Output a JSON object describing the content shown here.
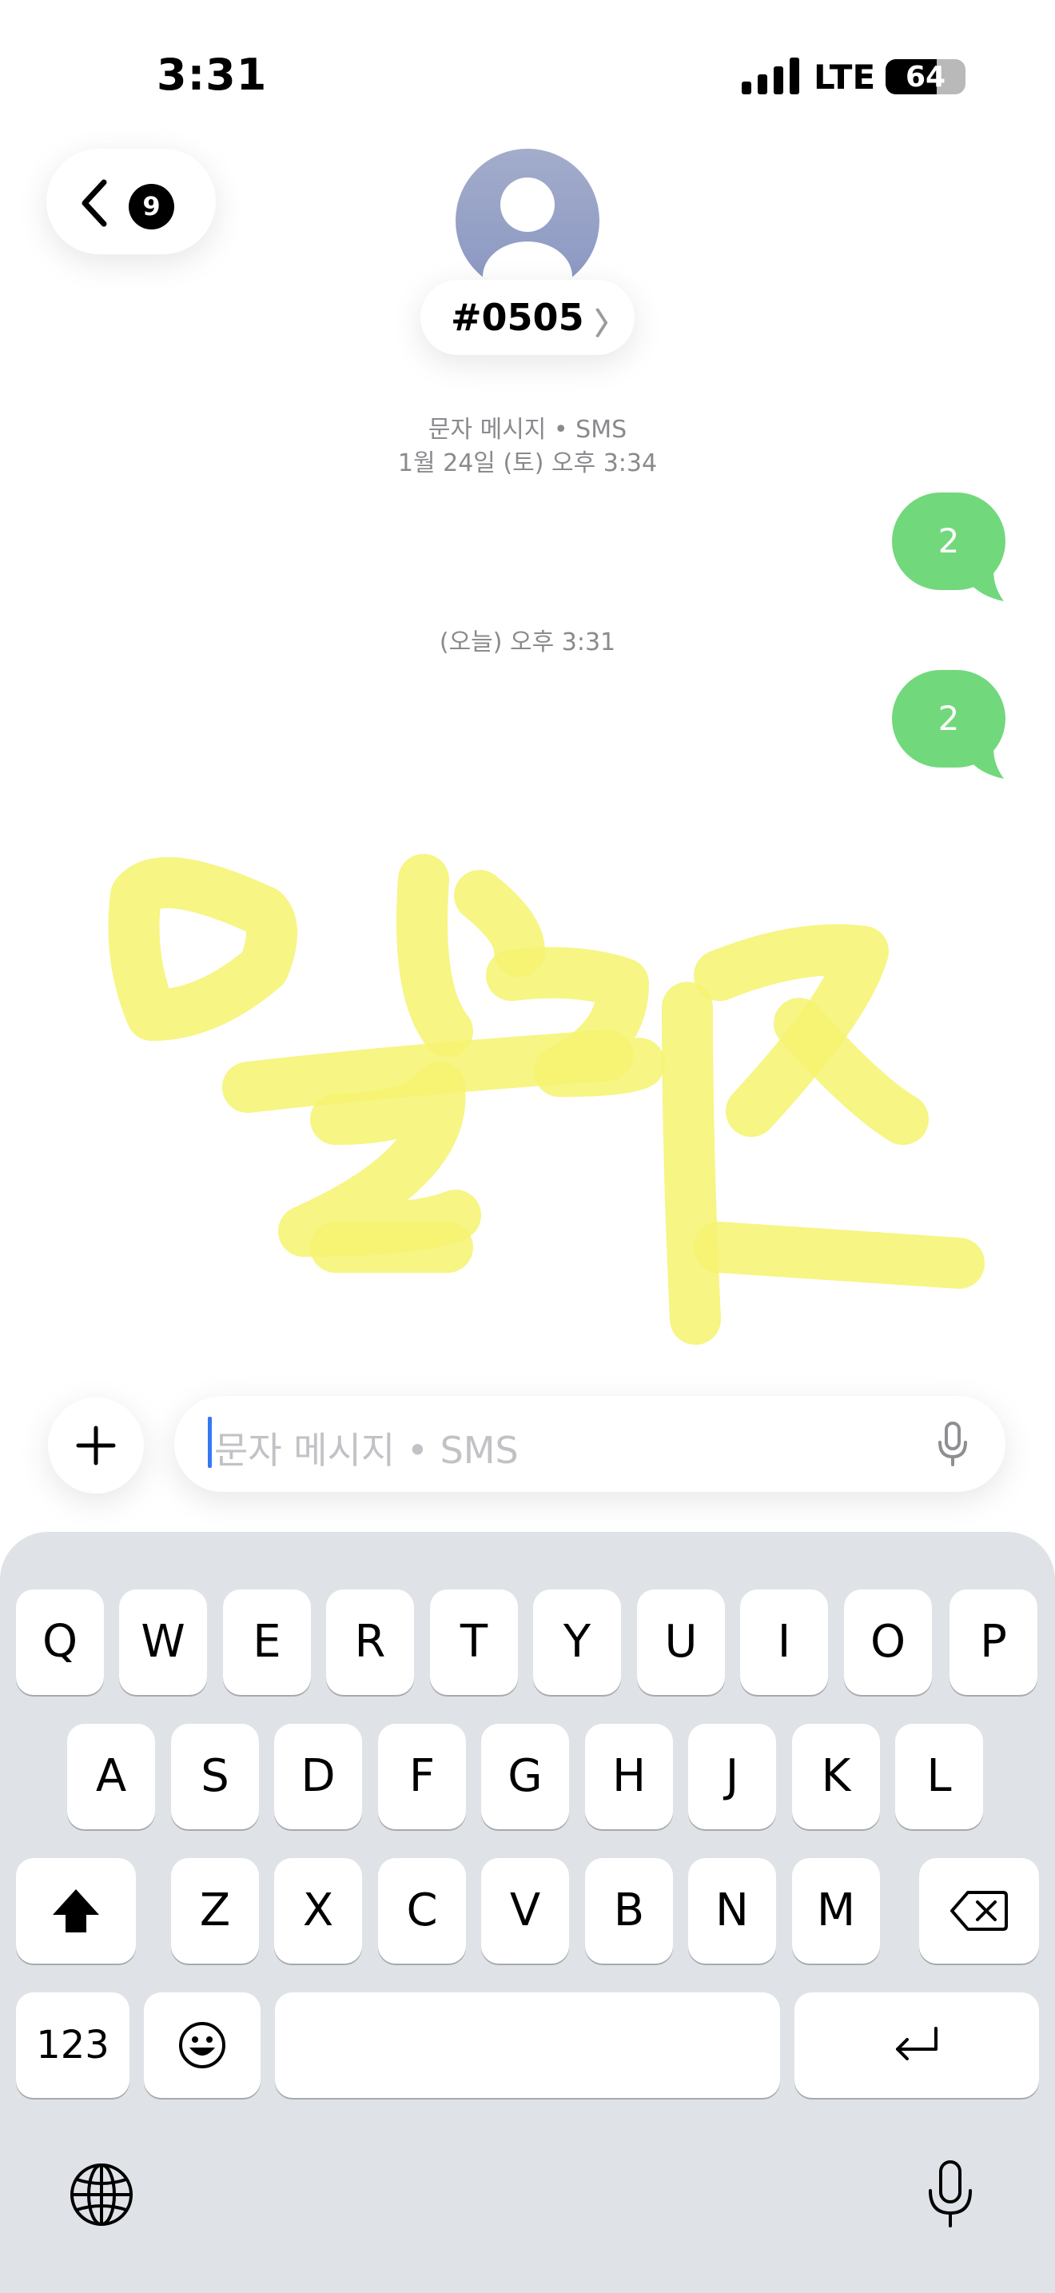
{
  "status_bar": {
    "time": "3:31",
    "network": "LTE",
    "battery": "64",
    "battery_level": 0.64
  },
  "header": {
    "back_count": "9",
    "contact_name": "#0505",
    "chevron": "〉"
  },
  "conversation": {
    "meta1_line1": "문자 메시지 • SMS",
    "meta1_line2": "1월 24일 (토) 오후 3:34",
    "msg1": "2",
    "meta2": "(오늘) 오후 3:31",
    "msg2": "2"
  },
  "composer": {
    "placeholder": "문자 메시지 • SMS"
  },
  "keyboard": {
    "row1": [
      "Q",
      "W",
      "E",
      "R",
      "T",
      "Y",
      "U",
      "I",
      "O",
      "P"
    ],
    "row2": [
      "A",
      "S",
      "D",
      "F",
      "G",
      "H",
      "J",
      "K",
      "L"
    ],
    "row3": [
      "Z",
      "X",
      "C",
      "V",
      "B",
      "N",
      "M"
    ],
    "numbers_key": "123"
  },
  "colors": {
    "bubble": "#72d87c",
    "highlighter": "#f6f36e",
    "keyboard_bg": "#dfe2e6"
  },
  "icons": [
    "back-chevron-icon",
    "avatar-icon",
    "plus-icon",
    "microphone-icon",
    "shift-icon",
    "backspace-icon",
    "emoji-icon",
    "return-icon",
    "globe-icon",
    "dictation-icon"
  ]
}
